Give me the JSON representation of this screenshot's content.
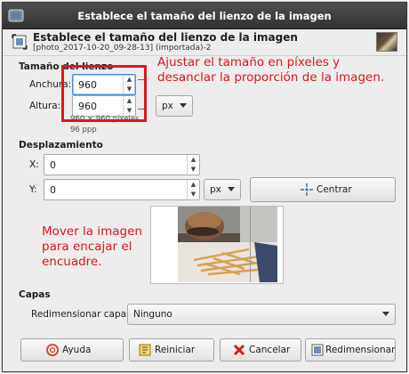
{
  "window": {
    "title": "Establece el tamaño del lienzo de la imagen"
  },
  "header": {
    "title": "Establece el tamaño del lienzo de la imagen",
    "subtitle": "[photo_2017-10-20_09-28-13] (importada)-2"
  },
  "canvas_size": {
    "section": "Tamaño del lienzo",
    "width_label": "Anchura:",
    "width_value": "960",
    "height_label": "Altura:",
    "height_value": "960",
    "unit": "px",
    "info_pixels": "960 × 960 píxeles",
    "info_ppp": "96 ppp"
  },
  "offset": {
    "section": "Desplazamiento",
    "x_label": "X:",
    "x_value": "0",
    "y_label": "Y:",
    "y_value": "0",
    "unit": "px",
    "center_label": "Centrar"
  },
  "layers": {
    "section": "Capas",
    "resize_label": "Redimensionar capas:",
    "resize_value": "Ninguno"
  },
  "buttons": {
    "help": "Ayuda",
    "reset": "Reiniciar",
    "cancel": "Cancelar",
    "resize": "Redimensionar"
  },
  "annotations": {
    "top": "Ajustar el tamaño en píxeles y desanclar la proporción de la imagen.",
    "middle": "Mover la imagen para encajar el encuadre."
  },
  "colors": {
    "annotation": "#e0141e",
    "titlebar": "#3c3c3c",
    "focus": "#4a90d9"
  }
}
